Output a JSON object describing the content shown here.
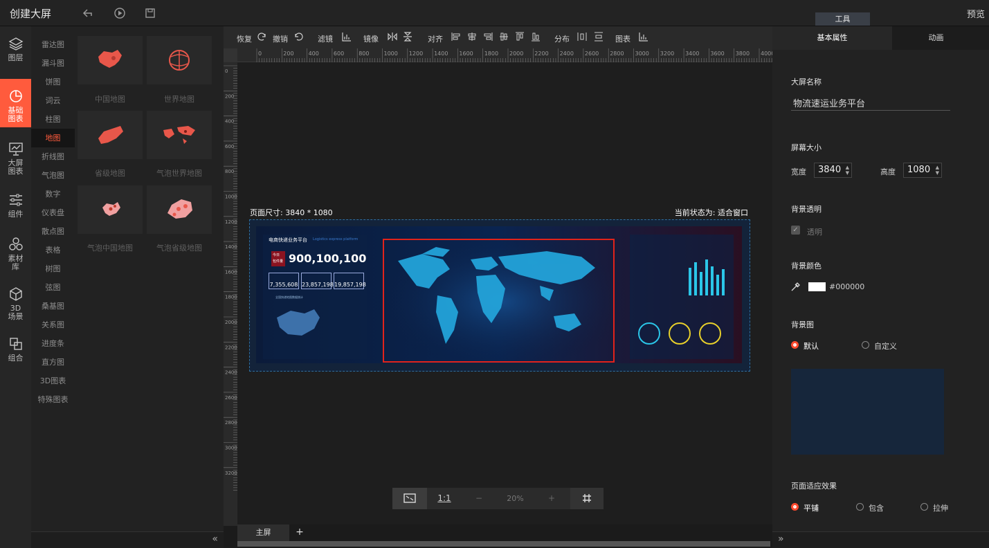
{
  "app_title": "创建大屏",
  "top": {
    "preview": "预览",
    "tools_tab": "工具"
  },
  "leftnav": [
    {
      "label": "图层",
      "icon": "layers-icon"
    },
    {
      "label": "基础图表",
      "icon": "pie-chart-icon",
      "active": true
    },
    {
      "label": "大屏图表",
      "icon": "presentation-chart-icon"
    },
    {
      "label": "组件",
      "icon": "sliders-icon"
    },
    {
      "label": "素材库",
      "icon": "assets-icon"
    },
    {
      "label": "3D场景",
      "icon": "cube-icon"
    },
    {
      "label": "组合",
      "icon": "group-icon"
    }
  ],
  "categories": [
    "雷达图",
    "漏斗图",
    "饼图",
    "词云",
    "柱图",
    "地图",
    "折线图",
    "气泡图",
    "数字",
    "仪表盘",
    "散点图",
    "表格",
    "树图",
    "弦图",
    "桑基图",
    "关系图",
    "进度条",
    "直方图",
    "3D图表",
    "特殊图表"
  ],
  "active_category": "地图",
  "thumbs": [
    "中国地图",
    "世界地图",
    "省级地图",
    "气泡世界地图",
    "气泡中国地图",
    "气泡省级地图"
  ],
  "toolbar": {
    "redo": "恢复",
    "undo": "撤销",
    "filter": "滤镜",
    "mirror": "镜像",
    "align": "对齐",
    "distribute": "分布",
    "chart": "图表"
  },
  "ruler_top": [
    "0",
    "200",
    "400",
    "600",
    "800",
    "1000",
    "1200",
    "1400",
    "1600",
    "1800",
    "2000",
    "2200",
    "2400",
    "2600",
    "2800",
    "3000",
    "3200",
    "3400",
    "3600",
    "3800",
    "4000"
  ],
  "ruler_left": [
    "0",
    "200",
    "400",
    "600",
    "800",
    "1000",
    "1200",
    "1400",
    "1600",
    "1800",
    "2000",
    "2200",
    "2400",
    "2600",
    "2800",
    "3000",
    "3200"
  ],
  "canvas": {
    "page_size": "页面尺寸: 3840 * 1080",
    "current_state": "当前状态为: 适合窗口"
  },
  "dashboard": {
    "title": "电商快递业务平台",
    "subtitle": "Logistics express platform",
    "today_label": "今日",
    "today_label2": "包件量",
    "big_number": "900,100,100",
    "stats": [
      "7,355,608",
      "23,857,198",
      "19,857,198"
    ],
    "china_panel": "全国快递地图数据统计"
  },
  "zoom": {
    "fit_label": "fit-screen",
    "one_to_one": "1:1",
    "minus": "−",
    "level": "20%",
    "plus": "+"
  },
  "pages": {
    "main": "主屏",
    "add": "+"
  },
  "right": {
    "tabs": [
      "基本属性",
      "动画"
    ],
    "screen_name_label": "大屏名称",
    "screen_name": "物流速运业务平台",
    "screen_size_label": "屏幕大小",
    "width_label": "宽度",
    "width": "3840",
    "height_label": "高度",
    "height": "1080",
    "bg_transparent_label": "背景透明",
    "transparent": "透明",
    "bg_color_label": "背景颜色",
    "bg_color": "#000000",
    "bg_image_label": "背景图",
    "bg_default": "默认",
    "bg_custom": "自定义",
    "fit_label": "页面适应效果",
    "fit_tile": "平铺",
    "fit_contain": "包含",
    "fit_stretch": "拉伸"
  },
  "colors": {
    "accent": "#ff5b3d",
    "select_frame": "#e2231a"
  }
}
